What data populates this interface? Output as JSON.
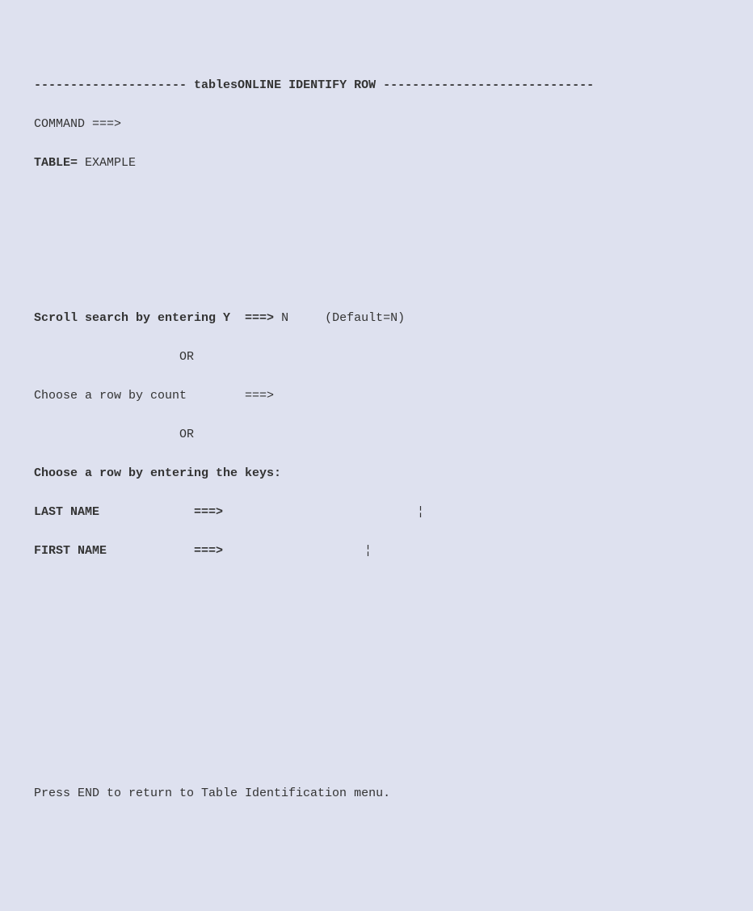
{
  "header": {
    "left_dashes": "--------------------- ",
    "title": "tablesONLINE IDENTIFY ROW",
    "right_dashes": " -----------------------------"
  },
  "command": {
    "label": "COMMAND ===>",
    "value": ""
  },
  "table": {
    "label": "TABLE= ",
    "value": "EXAMPLE"
  },
  "scroll_search": {
    "label": "Scroll search by entering Y  ===> ",
    "value": "N",
    "default_hint": "(Default=N)"
  },
  "or_separator": "                    OR",
  "row_by_count": {
    "label": "Choose a row by count        ===>",
    "value": ""
  },
  "row_by_keys": {
    "heading": "Choose a row by entering the keys:"
  },
  "last_name": {
    "label": "LAST NAME             ===>",
    "value": "",
    "bar": "¦"
  },
  "first_name": {
    "label": "FIRST NAME            ===>",
    "value": "",
    "bar": "¦"
  },
  "footer": {
    "hint": "Press END to return to Table Identification menu."
  }
}
